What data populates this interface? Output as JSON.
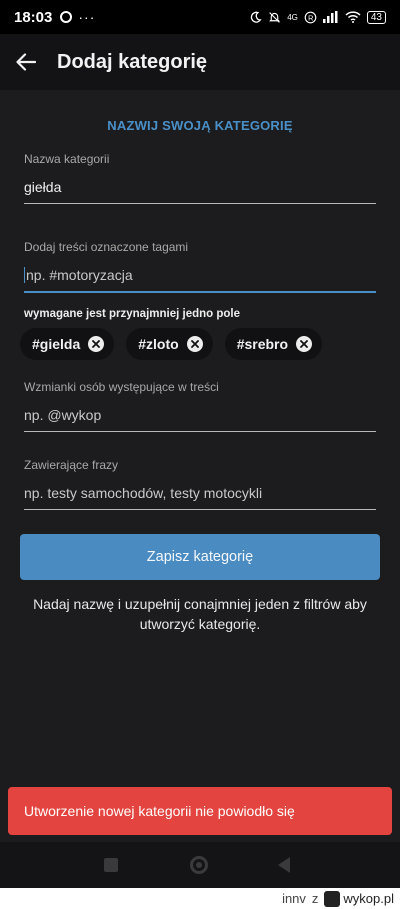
{
  "status_bar": {
    "time": "18:03",
    "dots": "···",
    "network": "4G",
    "battery": "43"
  },
  "app_bar": {
    "title": "Dodaj kategorię"
  },
  "form": {
    "section_title": "NAZWIJ SWOJĄ KATEGORIĘ",
    "name_field": {
      "label": "Nazwa kategorii",
      "value": "giełda"
    },
    "tags_field": {
      "label": "Dodaj treści oznaczone tagami",
      "placeholder": "np. #motoryzacja"
    },
    "required_hint": "wymagane jest przynajmniej jedno pole",
    "tags": [
      {
        "label": "#gielda"
      },
      {
        "label": "#zloto"
      },
      {
        "label": "#srebro"
      }
    ],
    "mentions_field": {
      "label": "Wzmianki osób występujące w treści",
      "placeholder": "np. @wykop"
    },
    "phrases_field": {
      "label": "Zawierające frazy",
      "placeholder": "np. testy samochodów, testy motocykli"
    },
    "save_button": "Zapisz kategorię",
    "info_text": "Nadaj nazwę i uzupełnij conajmniej jeden z filtrów aby utworzyć kategorię."
  },
  "toast": {
    "message": "Utworzenie nowej kategorii nie powiodło się"
  },
  "footer": {
    "user": "innv",
    "sep": "z",
    "site": "wykop.pl"
  },
  "colors": {
    "accent": "#4a90c8",
    "error": "#e3443f",
    "background": "#1c1c1e"
  }
}
